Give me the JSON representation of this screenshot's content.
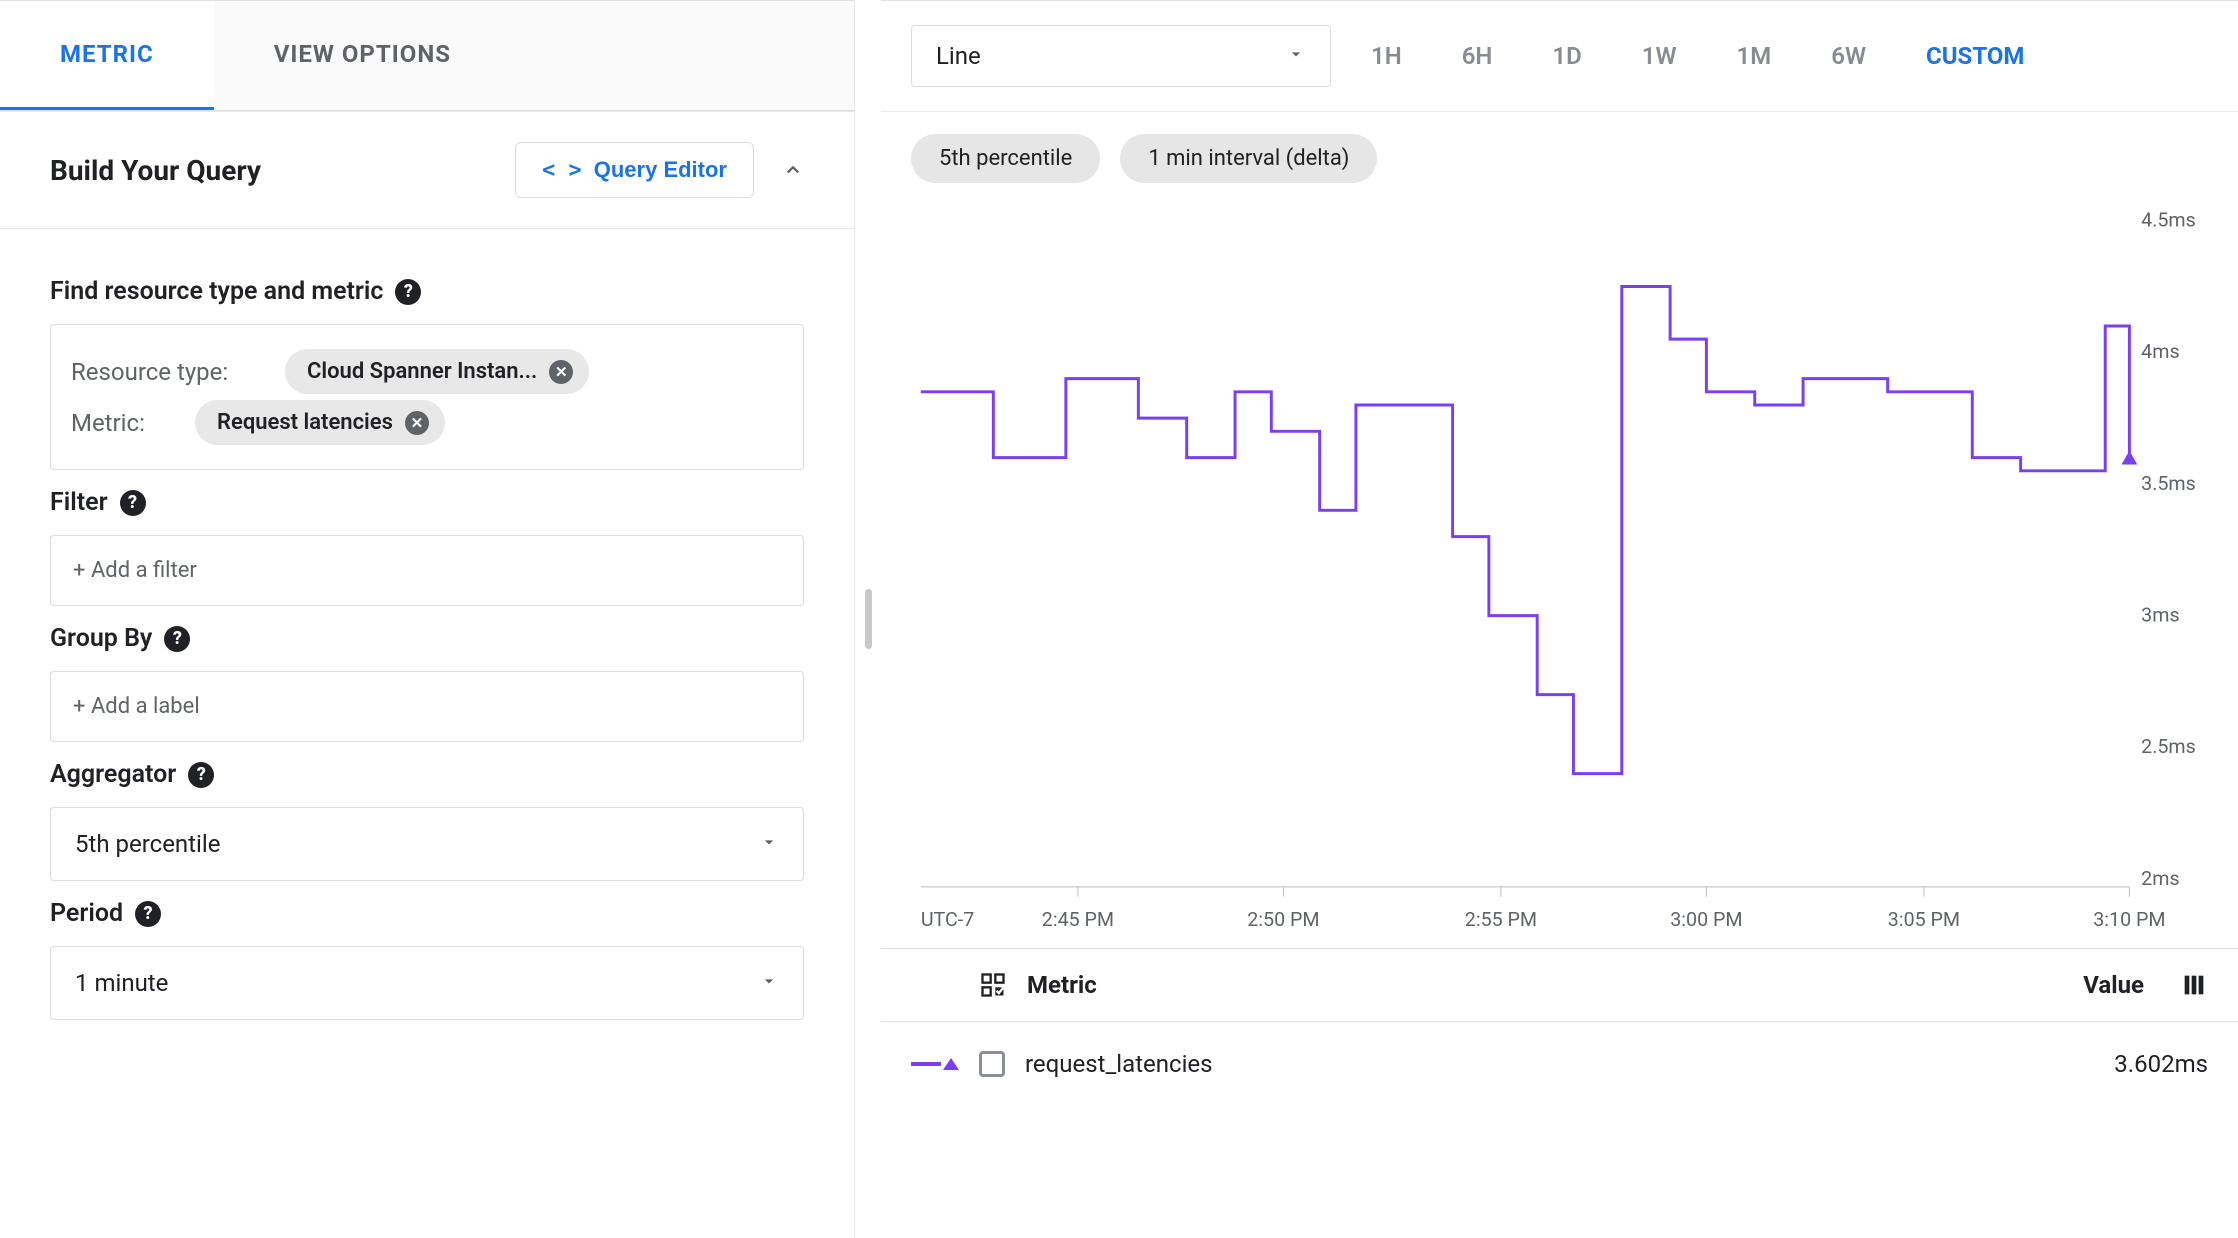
{
  "left": {
    "tabs": {
      "metric": "METRIC",
      "view_options": "VIEW OPTIONS",
      "active": "metric"
    },
    "build_query": {
      "title": "Build Your Query",
      "query_editor_label": "Query Editor",
      "find_label": "Find resource type and metric",
      "resource_type_label": "Resource type:",
      "resource_type_value": "Cloud Spanner Instan...",
      "metric_label": "Metric:",
      "metric_value": "Request latencies",
      "filter_label": "Filter",
      "filter_placeholder": "+ Add a filter",
      "groupby_label": "Group By",
      "groupby_placeholder": "+ Add a label",
      "aggregator_label": "Aggregator",
      "aggregator_value": "5th percentile",
      "period_label": "Period",
      "period_value": "1 minute"
    }
  },
  "toolbar": {
    "chart_type": "Line",
    "time_ranges": [
      "1H",
      "6H",
      "1D",
      "1W",
      "1M",
      "6W",
      "CUSTOM"
    ],
    "active_time_range": "CUSTOM"
  },
  "pills": [
    "5th percentile",
    "1 min interval (delta)"
  ],
  "chart_data": {
    "type": "line",
    "timezone": "UTC-7",
    "ylabel": "",
    "ylim": [
      2.0,
      4.5
    ],
    "y_unit": "ms",
    "x_ticks": [
      "2:45 PM",
      "2:50 PM",
      "2:55 PM",
      "3:00 PM",
      "3:05 PM",
      "3:10 PM"
    ],
    "y_ticks": [
      2.0,
      2.5,
      3.0,
      3.5,
      4.0,
      4.5
    ],
    "color": "#7b3ff2",
    "x": [
      0.0,
      0.03,
      0.06,
      0.09,
      0.12,
      0.15,
      0.18,
      0.22,
      0.26,
      0.29,
      0.33,
      0.36,
      0.4,
      0.44,
      0.47,
      0.51,
      0.54,
      0.58,
      0.62,
      0.65,
      0.69,
      0.73,
      0.76,
      0.8,
      0.84,
      0.87,
      0.91,
      0.95,
      0.98,
      1.0
    ],
    "y": [
      3.85,
      3.85,
      3.6,
      3.6,
      3.9,
      3.9,
      3.75,
      3.6,
      3.85,
      3.7,
      3.4,
      3.8,
      3.8,
      3.3,
      3.0,
      2.7,
      2.4,
      4.25,
      4.05,
      3.85,
      3.8,
      3.9,
      3.9,
      3.85,
      3.85,
      3.6,
      3.55,
      3.55,
      4.1,
      3.6
    ]
  },
  "legend": {
    "header_metric": "Metric",
    "header_value": "Value",
    "rows": [
      {
        "name": "request_latencies",
        "value": "3.602ms",
        "color": "#7b3ff2"
      }
    ]
  }
}
